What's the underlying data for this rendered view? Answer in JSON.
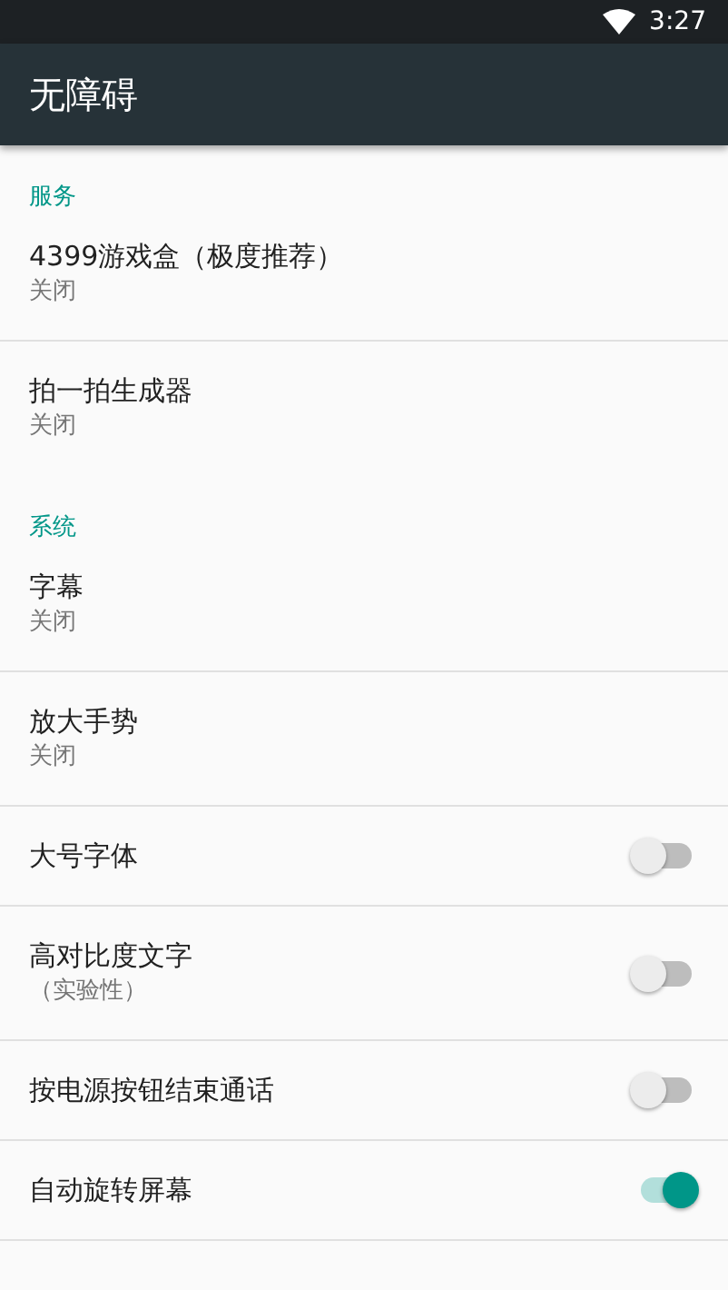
{
  "status_bar": {
    "time": "3:27"
  },
  "app_bar": {
    "title": "无障碍"
  },
  "sections": [
    {
      "title": "服务",
      "items": [
        {
          "kind": "link",
          "title": "4399游戏盒（极度推荐）",
          "summary": "关闭"
        },
        {
          "kind": "link",
          "title": "拍一拍生成器",
          "summary": "关闭"
        }
      ]
    },
    {
      "title": "系统",
      "items": [
        {
          "kind": "link",
          "title": "字幕",
          "summary": "关闭"
        },
        {
          "kind": "link",
          "title": "放大手势",
          "summary": "关闭"
        },
        {
          "kind": "toggle",
          "title": "大号字体",
          "on": false
        },
        {
          "kind": "toggle",
          "title": "高对比度文字",
          "summary": "（实验性）",
          "on": false
        },
        {
          "kind": "toggle",
          "title": "按电源按钮结束通话",
          "on": false
        },
        {
          "kind": "toggle",
          "title": "自动旋转屏幕",
          "on": true
        }
      ]
    }
  ]
}
